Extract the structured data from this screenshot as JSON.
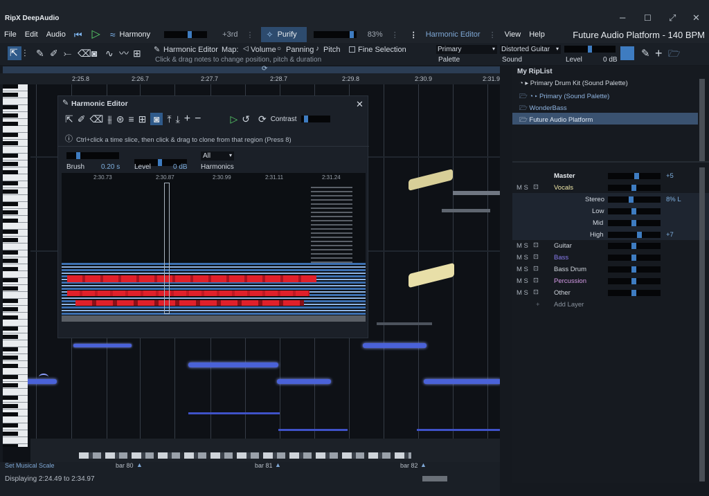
{
  "titlebar": {
    "app_name": "RipX DeepAudio",
    "controls": [
      "–",
      "☐",
      "⤢",
      "✕"
    ]
  },
  "menubar": {
    "items": [
      "File",
      "Edit",
      "Audio"
    ],
    "harmony_label": "Harmony",
    "pitch_shift": "+3rd",
    "purify_label": "Purify",
    "purify_value": "83%",
    "editor_label": "Harmonic Editor",
    "view": "View",
    "help": "Help",
    "project_title": "Future Audio Platform - 140 BPM"
  },
  "toolbar": {
    "mode_label": "Harmonic Editor",
    "map_label": "Map:",
    "volume": "Volume",
    "panning": "Panning",
    "pitch": "Pitch",
    "fine_selection": "Fine Selection",
    "hint": "Click & drag notes to change position, pitch & duration",
    "palette_select": "Primary",
    "palette_label": "Palette",
    "sound_select": "Distorted Guitar",
    "sound_label": "Sound",
    "level_label": "Level",
    "level_value": "0 dB"
  },
  "ruler": {
    "ticks": [
      "2:25.8",
      "2:26.7",
      "2:27.7",
      "2:28.7",
      "2:29.8",
      "2:30.9",
      "2:31.9"
    ]
  },
  "harmonic_editor": {
    "title": "Harmonic Editor",
    "contrast": "Contrast",
    "info": "Ctrl+click a time slice, then click & drag to clone from that region  (Press 8)",
    "brush_label": "Brush",
    "brush_value": "0.20 s",
    "level_label": "Level",
    "level_value": "0 dB",
    "harmonics_select": "All",
    "harmonics_label": "Harmonics",
    "spec_ticks": [
      "2:30.73",
      "2:30.87",
      "2:30.99",
      "2:31.11",
      "2:31.24"
    ]
  },
  "riplist": {
    "title": "My RipList",
    "items": [
      "Primary Drum Kit (Sound Palette)",
      "Primary (Sound Palette)",
      "WonderBass",
      "Future Audio Platform"
    ]
  },
  "mixer": {
    "master_label": "Master",
    "master_value": "+5",
    "vocals_label": "Vocals",
    "stereo_label": "Stereo",
    "stereo_value": "8% L",
    "low_label": "Low",
    "mid_label": "Mid",
    "high_label": "High",
    "high_value": "+7",
    "layers": [
      {
        "name": "Guitar",
        "color": "#d0d6dd"
      },
      {
        "name": "Bass",
        "color": "#8a7cf0"
      },
      {
        "name": "Bass Drum",
        "color": "#d0d6dd"
      },
      {
        "name": "Percussion",
        "color": "#d59ae6"
      },
      {
        "name": "Other",
        "color": "#d0d6dd"
      }
    ],
    "add_layer": "Add Layer",
    "ms": "M S"
  },
  "timeline": {
    "scale_label": "Set Musical Scale",
    "bars": [
      "bar 80",
      "bar 81",
      "bar 82"
    ]
  },
  "status": {
    "text": "Displaying 2:24.49 to 2:34.97"
  },
  "colors": {
    "accent": "#3e7cc1",
    "note_blue": "#5a6ff0",
    "note_yellow": "#e8dfa8",
    "spec_red": "#e0202a"
  }
}
